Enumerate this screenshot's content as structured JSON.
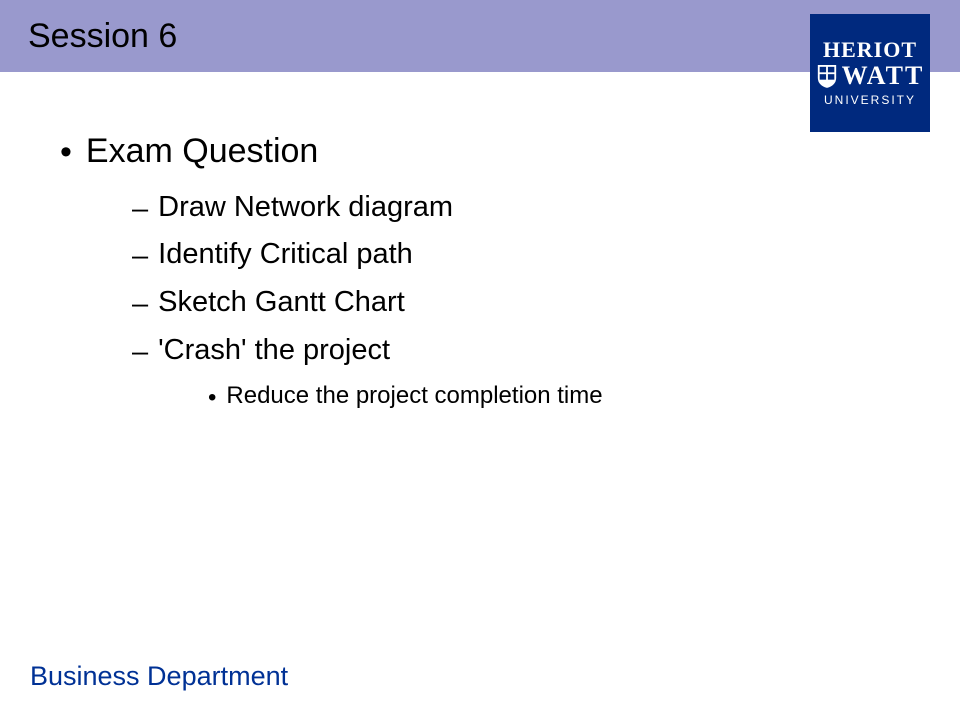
{
  "header": {
    "title": "Session 6"
  },
  "logo": {
    "line1": "HERIOT",
    "line2": "WATT",
    "line3": "UNIVERSITY"
  },
  "content": {
    "level1": "Exam Question",
    "sub": [
      "Draw Network diagram",
      "Identify Critical path",
      "Sketch Gantt Chart",
      "'Crash' the project"
    ],
    "subsub": "Reduce the project completion time"
  },
  "footer": "Business Department"
}
